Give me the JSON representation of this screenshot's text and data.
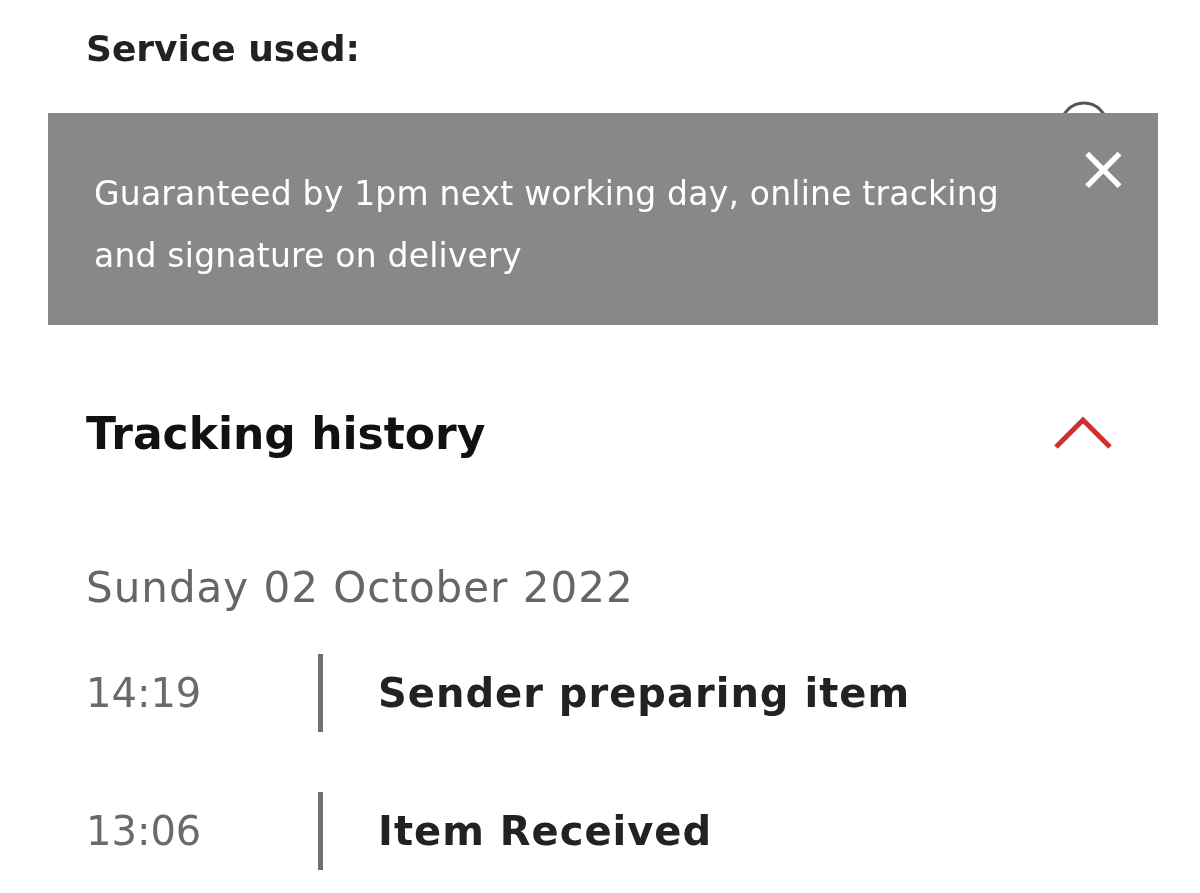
{
  "service": {
    "label": "Service used:"
  },
  "tooltip": {
    "text": "Guaranteed by 1pm next working day, online tracking and signature on delivery",
    "close": "×"
  },
  "tracking_history": {
    "title": "Tracking history",
    "expanded": true,
    "days": [
      {
        "date": "Sunday 02 October 2022",
        "events": [
          {
            "time": "14:19",
            "description": "Sender preparing item"
          },
          {
            "time": "13:06",
            "description": "Item Received"
          }
        ]
      }
    ]
  }
}
